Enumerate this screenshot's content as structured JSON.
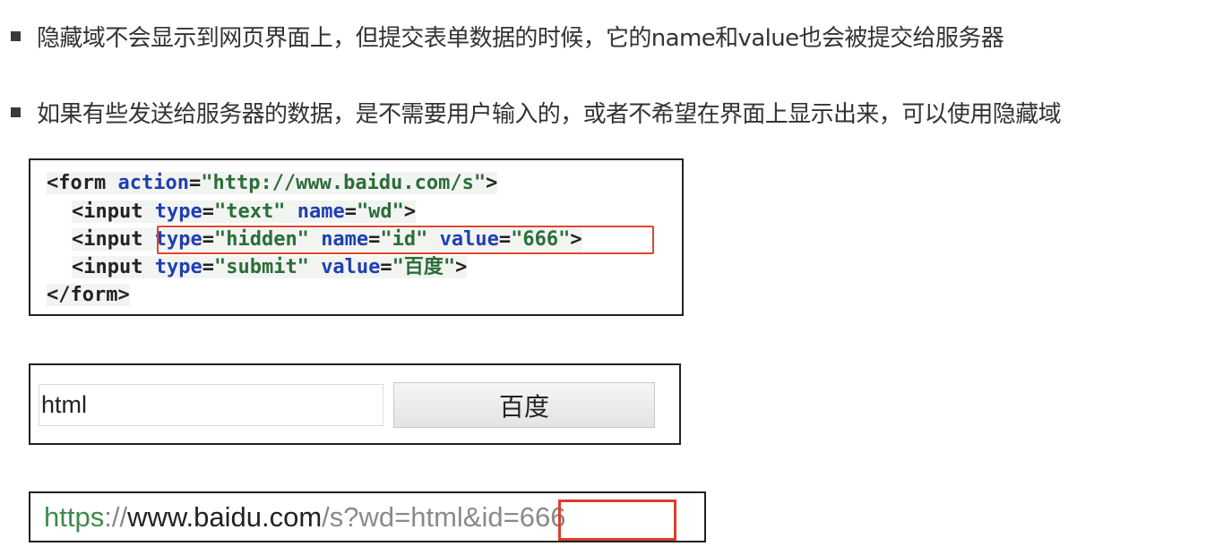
{
  "bullets": [
    "隐藏域不会显示到网页界面上，但提交表单数据的时候，它的name和value也会被提交给服务器",
    "如果有些发送给服务器的数据，是不需要用户输入的，或者不希望在界面上显示出来，可以使用隐藏域"
  ],
  "code": {
    "line1": {
      "tag_open": "<form",
      "attr": "action",
      "eq": "=",
      "value": "\"http://www.baidu.com/s\"",
      "close": ">"
    },
    "line2": {
      "tag_open": "<input",
      "attr1": "type",
      "value1": "\"text\"",
      "attr2": "name",
      "value2": "\"wd\"",
      "close": ">"
    },
    "line3": {
      "tag_open": "<input",
      "attr1": "type",
      "value1": "\"hidden\"",
      "attr2": "name",
      "value2": "\"id\"",
      "attr3": "value",
      "value3": "\"666\"",
      "close": ">"
    },
    "line4": {
      "tag_open": "<input",
      "attr1": "type",
      "value1": "\"submit\"",
      "attr2": "value",
      "value2": "\"百度\"",
      "close": ">"
    },
    "line5": {
      "tag_close": "</form>"
    }
  },
  "form_preview": {
    "input_value": "html",
    "submit_label": "百度"
  },
  "url": {
    "scheme": "https",
    "separator": "://",
    "host": "www.baidu.com",
    "path_query": "/s?wd=html&id=666"
  },
  "colors": {
    "highlight_border": "#e0452f",
    "attr_blue": "#1f3fb2",
    "value_green": "#2c6d3a",
    "scheme_green": "#3e8a4a"
  }
}
